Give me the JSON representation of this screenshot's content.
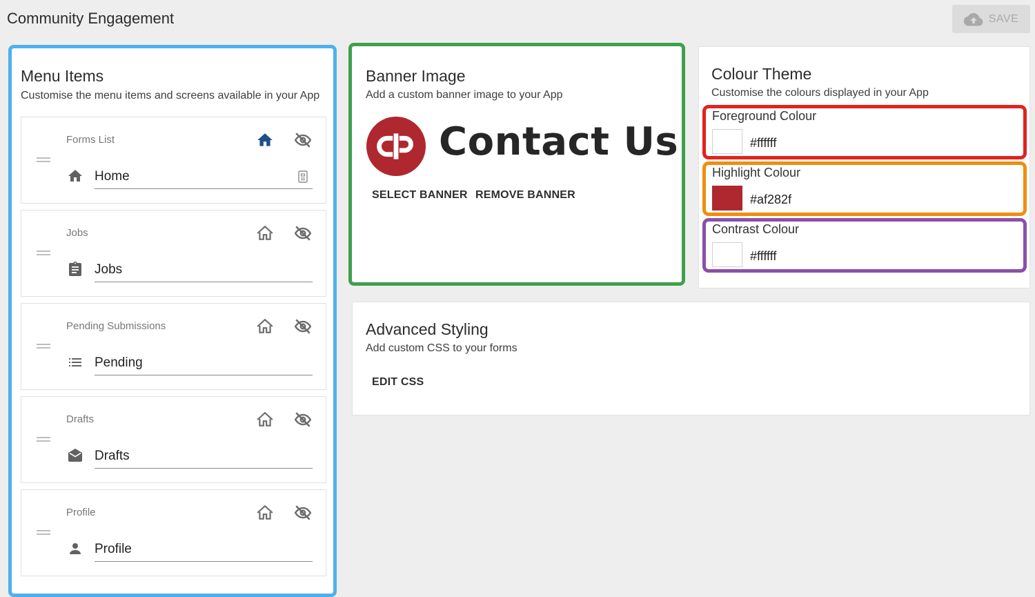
{
  "header": {
    "title": "Community Engagement",
    "save_label": "SAVE"
  },
  "menu_panel": {
    "title": "Menu Items",
    "subtitle": "Customise the menu items and screens available in your App",
    "items": [
      {
        "label": "Forms List",
        "value": "Home",
        "icon": "home-icon",
        "is_home": true
      },
      {
        "label": "Jobs",
        "value": "Jobs",
        "icon": "clipboard-icon",
        "is_home": false
      },
      {
        "label": "Pending Submissions",
        "value": "Pending",
        "icon": "list-icon",
        "is_home": false
      },
      {
        "label": "Drafts",
        "value": "Drafts",
        "icon": "drafts-icon",
        "is_home": false
      },
      {
        "label": "Profile",
        "value": "Profile",
        "icon": "person-icon",
        "is_home": false
      }
    ]
  },
  "banner_panel": {
    "title": "Banner Image",
    "subtitle": "Add a custom banner image to your App",
    "banner_text": "Contact Us",
    "select_label": "SELECT BANNER",
    "remove_label": "REMOVE BANNER"
  },
  "colour_panel": {
    "title": "Colour Theme",
    "subtitle": "Customise the colours displayed in your App",
    "fields": [
      {
        "label": "Foreground Colour",
        "value": "#ffffff",
        "outline": "#e1231f"
      },
      {
        "label": "Highlight Colour",
        "value": "#af282f",
        "outline": "#ef8e10"
      },
      {
        "label": "Contrast Colour",
        "value": "#ffffff",
        "outline": "#8c4fa8"
      }
    ]
  },
  "advanced_panel": {
    "title": "Advanced Styling",
    "subtitle": "Add custom CSS to your forms",
    "edit_label": "EDIT CSS"
  },
  "colors": {
    "home_active": "#1e4f8a",
    "icon_grey": "#6b6b6b",
    "brand_red": "#af282f"
  }
}
